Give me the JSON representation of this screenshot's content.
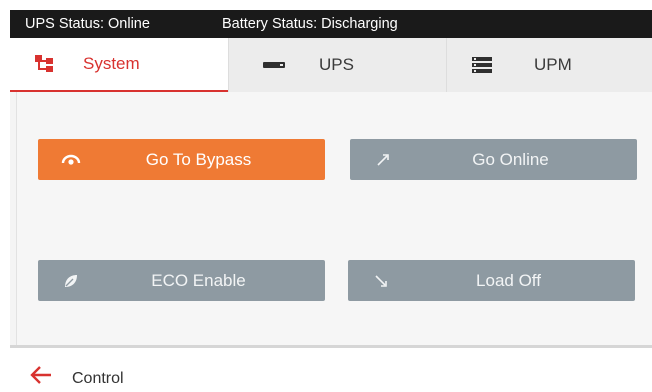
{
  "status_bar": {
    "ups_status": "UPS Status: Online",
    "battery_status": "Battery Status: Discharging"
  },
  "tabs": [
    {
      "label": "System",
      "icon": "hierarchy-icon",
      "active": true
    },
    {
      "label": "UPS",
      "icon": "ups-icon",
      "active": false
    },
    {
      "label": "UPM",
      "icon": "server-stack-icon",
      "active": false
    }
  ],
  "actions": {
    "go_to_bypass": {
      "label": "Go To Bypass",
      "icon": "bypass-icon"
    },
    "go_online": {
      "label": "Go Online",
      "icon": "arrow-up-right-icon"
    },
    "eco_enable": {
      "label": "ECO  Enable",
      "icon": "leaf-icon"
    },
    "load_off": {
      "label": "Load Off",
      "icon": "arrow-down-right-icon"
    }
  },
  "footer": {
    "label": "Control",
    "icon": "back-arrow-icon"
  },
  "colors": {
    "accent_red": "#d8322f",
    "primary_orange": "#ef7a34",
    "button_grey": "#8e9aa2",
    "status_bar_bg": "#1a1a1a"
  }
}
